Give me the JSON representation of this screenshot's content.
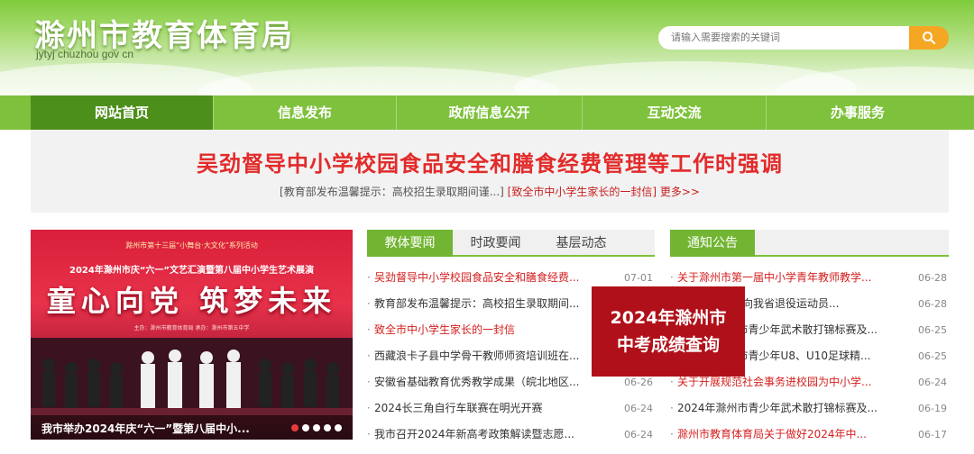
{
  "header": {
    "title": "滁州市教育体育局",
    "domain": "jytyj chuzhou gov cn",
    "search_placeholder": "请输入需要搜索的关键词"
  },
  "nav": {
    "items": [
      {
        "label": "网站首页"
      },
      {
        "label": "信息发布"
      },
      {
        "label": "政府信息公开"
      },
      {
        "label": "互动交流"
      },
      {
        "label": "办事服务"
      }
    ]
  },
  "headline": {
    "title": "吴劲督导中小学校园食品安全和膳食经费管理等工作时强调",
    "sub1": "[教育部发布温馨提示：高校招生录取期间谨...]",
    "sub2": "[致全市中小学生家长的一封信]",
    "more": "更多>>"
  },
  "carousel": {
    "line1": "滁州市第十三届“小舞台·大文化”系列活动",
    "line2": "2024年滁州市庆“六一”文艺汇演暨第八届中小学生艺术展演",
    "slogan": "童心向党  筑梦未来",
    "small": "主办：滁州市教育体育局  承办：滁州市第五中学",
    "caption": "我市举办2024年庆“六一”暨第八届中小..."
  },
  "news": {
    "tabs": [
      "教体要闻",
      "时政要闻",
      "基层动态"
    ],
    "items": [
      {
        "title": "吴劲督导中小学校园食品安全和膳食经费...",
        "date": "07-01",
        "red": true
      },
      {
        "title": "教育部发布温馨提示：高校招生录取期间...",
        "date": "",
        "red": false
      },
      {
        "title": "致全市中小学生家长的一封信",
        "date": "",
        "red": true
      },
      {
        "title": "西藏浪卡子县中学骨干教师师资培训班在...",
        "date": "",
        "red": false
      },
      {
        "title": "安徽省基础教育优秀教学成果（皖北地区...",
        "date": "06-26",
        "red": false
      },
      {
        "title": "2024长三角自行车联赛在明光开赛",
        "date": "06-24",
        "red": false
      },
      {
        "title": "我市召开2024年新高考政策解读暨志愿...",
        "date": "06-24",
        "red": false
      }
    ]
  },
  "popup": {
    "line1": "2024年滁州市",
    "line2": "中考成绩查询"
  },
  "notices": {
    "tab": "通知公告",
    "items": [
      {
        "title": "关于滁州市第一届中小学青年教师教学...",
        "date": "06-28",
        "red": true
      },
      {
        "title": "关于滁州市面向我省退役运动员...",
        "date": "06-28",
        "red": false
      },
      {
        "title": "2024年滁州市青少年武术散打锦标赛及...",
        "date": "06-25",
        "red": false
      },
      {
        "title": "2024年滁州市青少年U8、U10足球精...",
        "date": "06-25",
        "red": false
      },
      {
        "title": "关于开展规范社会事务进校园为中小学...",
        "date": "06-24",
        "red": true
      },
      {
        "title": "2024年滁州市青少年武术散打锦标赛及...",
        "date": "06-19",
        "red": false
      },
      {
        "title": "滁州市教育体育局关于做好2024年中...",
        "date": "06-17",
        "red": true
      }
    ]
  },
  "colors": {
    "nav_green": "#7ec13c",
    "nav_active": "#4d8f1b",
    "headline_red": "#e22b2b",
    "popup_red": "#b0101a",
    "search_orange": "#f5a623"
  },
  "icons": [
    "search-icon"
  ]
}
